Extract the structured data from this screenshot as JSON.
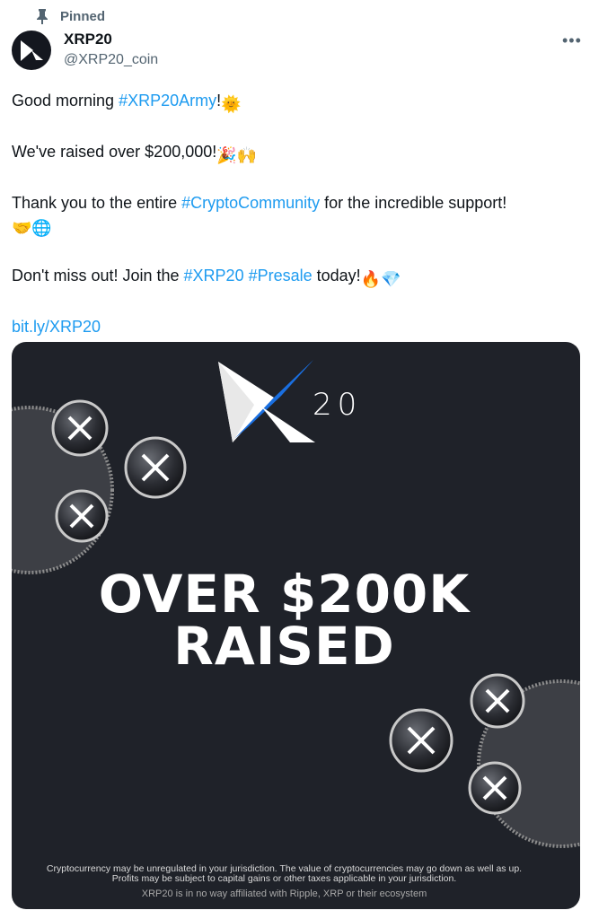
{
  "header": {
    "pinned_label": "Pinned",
    "display_name": "XRP20",
    "handle": "@XRP20_coin",
    "more_label": "•••"
  },
  "tweet": {
    "line1_prefix": "Good morning ",
    "line1_tag": "#XRP20Army",
    "line1_suffix": "!",
    "line1_emoji": "🌞",
    "line2_text": "We've raised over $200,000!",
    "line2_emoji": "🎉🙌",
    "line3_prefix": "Thank you to the entire ",
    "line3_tag": "#CryptoCommunity",
    "line3_suffix": " for the incredible support!",
    "line3_emoji": "🤝🌐",
    "line4_prefix": "Don't miss out! Join the ",
    "line4_tag1": "#XRP20",
    "line4_tag2": "#Presale",
    "line4_suffix": " today!",
    "line4_emoji": "🔥💎",
    "link": "bit.ly/XRP20"
  },
  "media": {
    "brand_text": "20",
    "headline_line1": "OVER $200K",
    "headline_line2": "RAISED",
    "disclaimer_line1": "Cryptocurrency may be unregulated in your jurisdiction. The value of cryptocurrencies may go  down as well as up. Profits may be subject to capital gains or other taxes applicable in your jurisdiction.",
    "disclaimer_line2": "XRP20 is in no way affiliated with Ripple, XRP or their ecosystem"
  },
  "colors": {
    "link": "#1d9bf0",
    "card_background": "#1f2229",
    "brand_blue": "#1a6fe0"
  }
}
